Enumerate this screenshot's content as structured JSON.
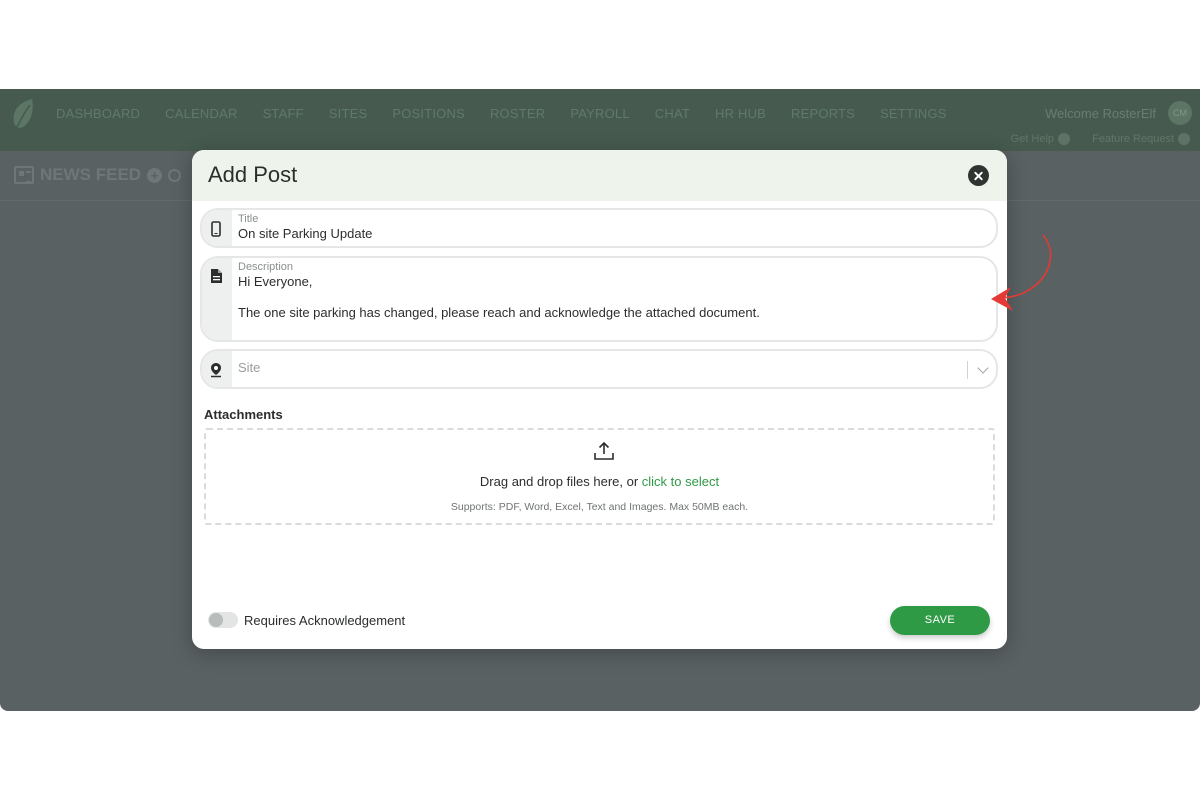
{
  "nav": {
    "items": [
      "DASHBOARD",
      "CALENDAR",
      "STAFF",
      "SITES",
      "POSITIONS",
      "ROSTER",
      "PAYROLL",
      "CHAT",
      "HR HUB",
      "REPORTS",
      "SETTINGS"
    ],
    "welcome": "Welcome RosterElf",
    "avatar_initials": "CM",
    "get_help": "Get Help",
    "feature_request": "Feature Request"
  },
  "page": {
    "title": "NEWS FEED"
  },
  "modal": {
    "title": "Add Post",
    "title_field": {
      "label": "Title",
      "value": "On site Parking Update",
      "icon": "smartphone-icon"
    },
    "description_field": {
      "label": "Description",
      "line1": "Hi Everyone,",
      "line2": "The one site parking has changed, please reach and acknowledge the attached document.",
      "icon": "document-icon"
    },
    "site_field": {
      "placeholder": "Site",
      "icon": "location-pin-icon"
    },
    "attachments": {
      "label": "Attachments",
      "drop_text": "Drag and drop files here, or ",
      "drop_link": "click to select",
      "supports": "Supports: PDF, Word, Excel, Text and Images. Max 50MB each."
    },
    "acknowledgement": {
      "label": "Requires Acknowledgement",
      "enabled": false
    },
    "save_label": "SAVE"
  },
  "colors": {
    "accent": "#2f9a45",
    "overlay": "#5a6163",
    "header_bg": "#eef4ec",
    "annotation": "#e53935"
  }
}
